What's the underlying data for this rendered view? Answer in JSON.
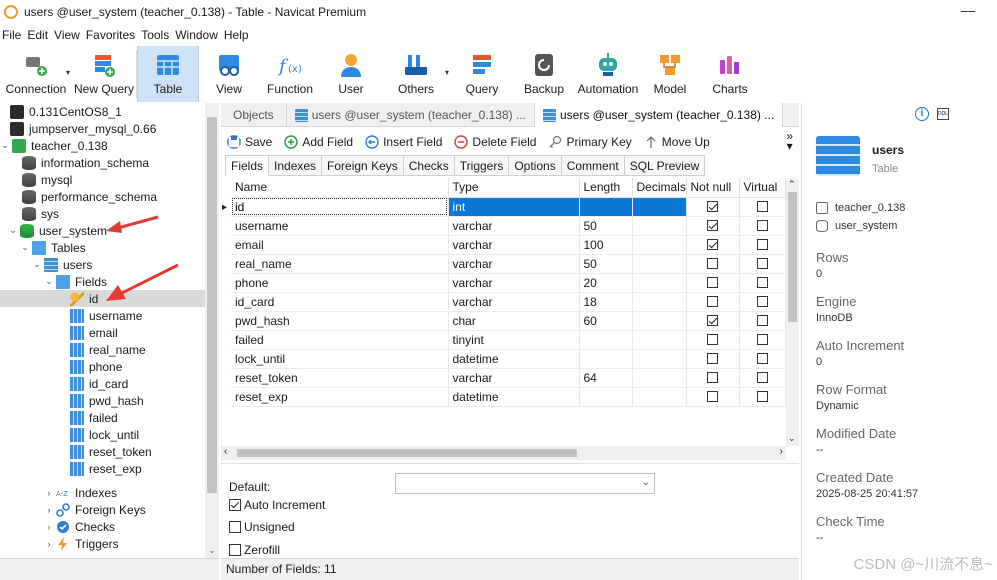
{
  "window": {
    "title": "users @user_system (teacher_0.138) - Table - Navicat Premium",
    "minimize_glyph": "—"
  },
  "menu": [
    "File",
    "Edit",
    "View",
    "Favorites",
    "Tools",
    "Window",
    "Help"
  ],
  "toolbar": [
    {
      "label": "Connection",
      "icon": "connection-icon",
      "caret": true
    },
    {
      "label": "New Query",
      "icon": "new-query-icon"
    },
    {
      "label": "Table",
      "icon": "table-icon",
      "active": true
    },
    {
      "label": "View",
      "icon": "view-icon"
    },
    {
      "label": "Function",
      "icon": "function-icon"
    },
    {
      "label": "User",
      "icon": "user-icon"
    },
    {
      "label": "Others",
      "icon": "others-icon",
      "caret": true
    },
    {
      "label": "Query",
      "icon": "query-icon"
    },
    {
      "label": "Backup",
      "icon": "backup-icon"
    },
    {
      "label": "Automation",
      "icon": "automation-icon"
    },
    {
      "label": "Model",
      "icon": "model-icon"
    },
    {
      "label": "Charts",
      "icon": "charts-icon"
    }
  ],
  "tree": [
    {
      "label": "0.131CentOS8_1",
      "icon": "connection",
      "indent": 0
    },
    {
      "label": "jumpserver_mysql_0.66",
      "icon": "connection",
      "indent": 0
    },
    {
      "label": "teacher_0.138",
      "icon": "connection-green",
      "indent": 0,
      "expander": "open"
    },
    {
      "label": "information_schema",
      "icon": "database",
      "indent": 1
    },
    {
      "label": "mysql",
      "icon": "database",
      "indent": 1
    },
    {
      "label": "performance_schema",
      "icon": "database",
      "indent": 1
    },
    {
      "label": "sys",
      "icon": "database",
      "indent": 1
    },
    {
      "label": "user_system",
      "icon": "database-green",
      "indent": 1,
      "expander": "open"
    },
    {
      "label": "Tables",
      "icon": "folder",
      "indent": 2,
      "expander": "open"
    },
    {
      "label": "users",
      "icon": "table",
      "indent": 3,
      "expander": "open"
    },
    {
      "label": "Fields",
      "icon": "folder",
      "indent": 4,
      "expander": "open"
    },
    {
      "label": "id",
      "icon": "key",
      "indent": 5,
      "selected": true
    },
    {
      "label": "username",
      "icon": "field",
      "indent": 5
    },
    {
      "label": "email",
      "icon": "field",
      "indent": 5
    },
    {
      "label": "real_name",
      "icon": "field",
      "indent": 5
    },
    {
      "label": "phone",
      "icon": "field",
      "indent": 5
    },
    {
      "label": "id_card",
      "icon": "field",
      "indent": 5
    },
    {
      "label": "pwd_hash",
      "icon": "field",
      "indent": 5
    },
    {
      "label": "failed",
      "icon": "field",
      "indent": 5
    },
    {
      "label": "lock_until",
      "icon": "field",
      "indent": 5
    },
    {
      "label": "reset_token",
      "icon": "field",
      "indent": 5
    },
    {
      "label": "reset_exp",
      "icon": "field",
      "indent": 5
    },
    {
      "label": "Indexes",
      "icon": "indexes",
      "indent": 4,
      "expander": "closed"
    },
    {
      "label": "Foreign Keys",
      "icon": "foreign-keys",
      "indent": 4,
      "expander": "closed"
    },
    {
      "label": "Checks",
      "icon": "checks",
      "indent": 4,
      "expander": "closed"
    },
    {
      "label": "Triggers",
      "icon": "triggers",
      "indent": 4,
      "expander": "closed"
    }
  ],
  "tabs": [
    {
      "label": "Objects",
      "active": false
    },
    {
      "label": "users @user_system (teacher_0.138) ...",
      "active": false
    },
    {
      "label": "users @user_system (teacher_0.138) ...",
      "active": true
    }
  ],
  "actions": [
    {
      "label": "Save",
      "icon": "save-icon",
      "color": "#3b73c4"
    },
    {
      "label": "Add Field",
      "icon": "add-field-icon",
      "color": "#2f9a3f"
    },
    {
      "label": "Insert Field",
      "icon": "insert-field-icon",
      "color": "#2e7fd0"
    },
    {
      "label": "Delete Field",
      "icon": "delete-field-icon",
      "color": "#d23b3b"
    },
    {
      "label": "Primary Key",
      "icon": "primary-key-icon",
      "color": "#777777"
    },
    {
      "label": "Move Up",
      "icon": "move-up-icon",
      "color": "#777777"
    }
  ],
  "subtabs": [
    "Fields",
    "Indexes",
    "Foreign Keys",
    "Checks",
    "Triggers",
    "Options",
    "Comment",
    "SQL Preview"
  ],
  "grid": {
    "columns": [
      "Name",
      "Type",
      "Length",
      "Decimals",
      "Not null",
      "Virtual"
    ],
    "rows": [
      {
        "name": "id",
        "type": "int",
        "length": "",
        "decimals": "",
        "not_null": true,
        "virtual": false,
        "selected": true
      },
      {
        "name": "username",
        "type": "varchar",
        "length": "50",
        "decimals": "",
        "not_null": true,
        "virtual": false
      },
      {
        "name": "email",
        "type": "varchar",
        "length": "100",
        "decimals": "",
        "not_null": true,
        "virtual": false
      },
      {
        "name": "real_name",
        "type": "varchar",
        "length": "50",
        "decimals": "",
        "not_null": false,
        "virtual": false
      },
      {
        "name": "phone",
        "type": "varchar",
        "length": "20",
        "decimals": "",
        "not_null": false,
        "virtual": false
      },
      {
        "name": "id_card",
        "type": "varchar",
        "length": "18",
        "decimals": "",
        "not_null": false,
        "virtual": false
      },
      {
        "name": "pwd_hash",
        "type": "char",
        "length": "60",
        "decimals": "",
        "not_null": true,
        "virtual": false
      },
      {
        "name": "failed",
        "type": "tinyint",
        "length": "",
        "decimals": "",
        "not_null": false,
        "virtual": false
      },
      {
        "name": "lock_until",
        "type": "datetime",
        "length": "",
        "decimals": "",
        "not_null": false,
        "virtual": false
      },
      {
        "name": "reset_token",
        "type": "varchar",
        "length": "64",
        "decimals": "",
        "not_null": false,
        "virtual": false
      },
      {
        "name": "reset_exp",
        "type": "datetime",
        "length": "",
        "decimals": "",
        "not_null": false,
        "virtual": false
      }
    ]
  },
  "field_props": {
    "default_label": "Default:",
    "default_value": "",
    "auto_increment": {
      "label": "Auto Increment",
      "checked": true
    },
    "unsigned": {
      "label": "Unsigned",
      "checked": false
    },
    "zerofill": {
      "label": "Zerofill",
      "checked": false
    }
  },
  "status": {
    "text": "Number of Fields: 11"
  },
  "right_panel": {
    "name": "users",
    "type": "Table",
    "connection": "teacher_0.138",
    "database": "user_system",
    "props": [
      {
        "label": "Rows",
        "value": "0"
      },
      {
        "label": "Engine",
        "value": "InnoDB"
      },
      {
        "label": "Auto Increment",
        "value": "0"
      },
      {
        "label": "Row Format",
        "value": "Dynamic"
      },
      {
        "label": "Modified Date",
        "value": "--"
      },
      {
        "label": "Created Date",
        "value": "2025-08-25 20:41:57"
      },
      {
        "label": "Check Time",
        "value": "--"
      }
    ]
  },
  "watermark": "CSDN @~川流不息~",
  "colors": {
    "selection": "#0b78d6",
    "accent_red_arrow": "#e53935",
    "active_toolbar": "#cfe3f7"
  }
}
